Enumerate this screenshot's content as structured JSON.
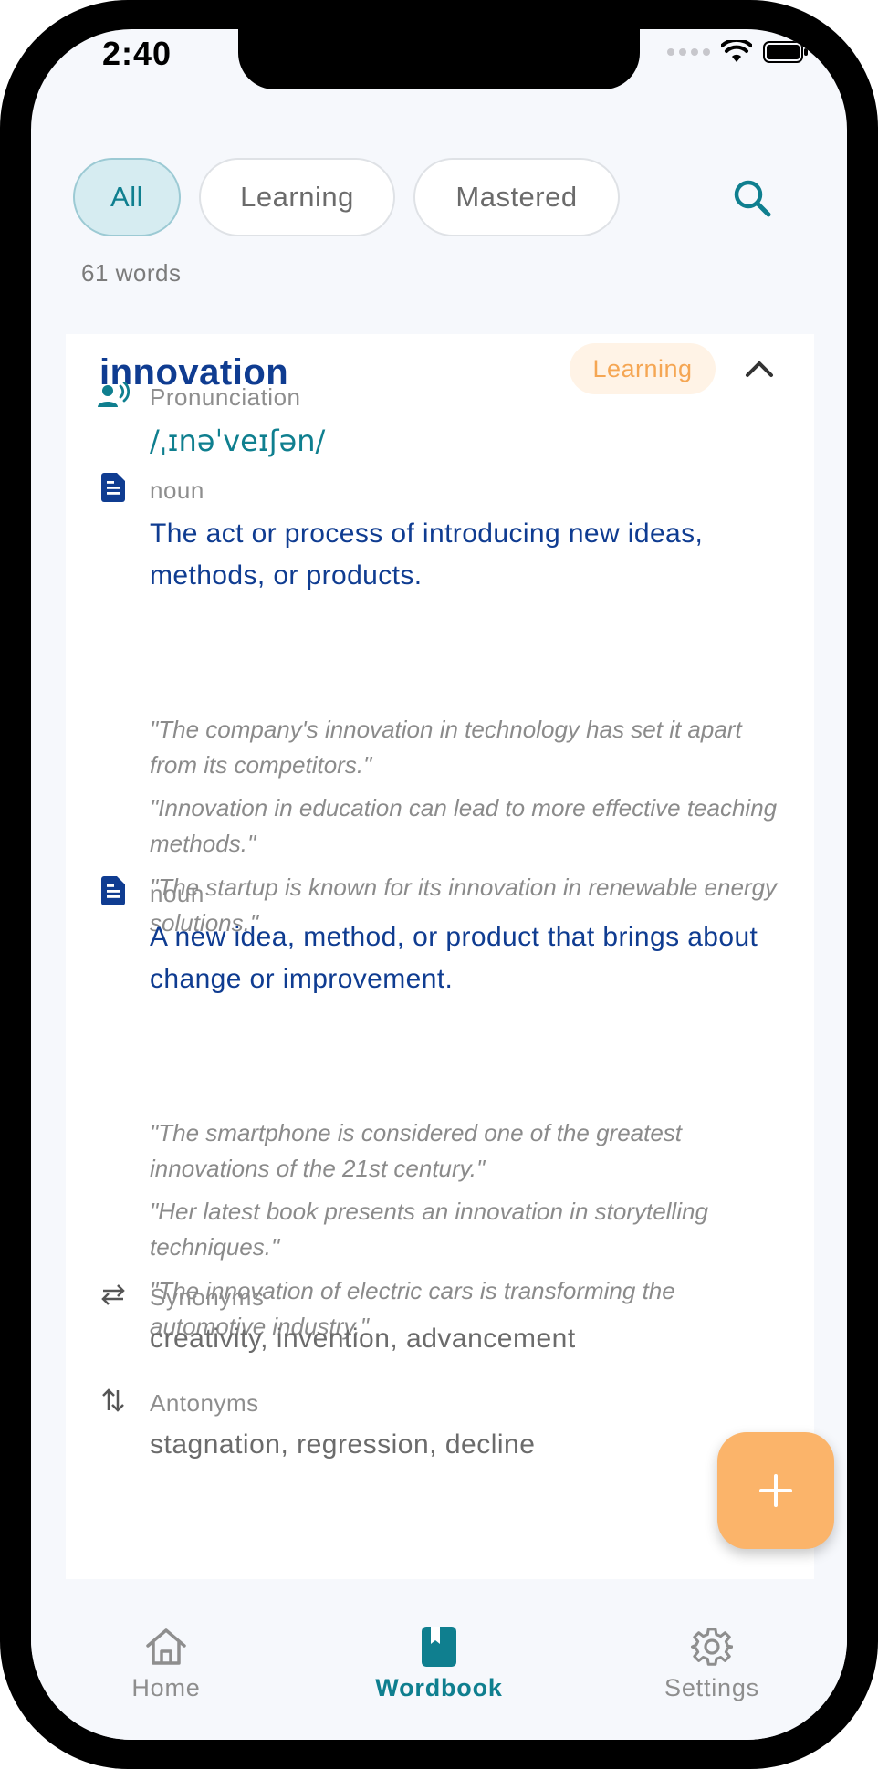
{
  "status_bar": {
    "time": "2:40"
  },
  "filters": {
    "items": [
      {
        "label": "All",
        "active": true
      },
      {
        "label": "Learning",
        "active": false
      },
      {
        "label": "Mastered",
        "active": false
      }
    ]
  },
  "word_count": "61 words",
  "card": {
    "word": "innovation",
    "status": "Learning",
    "pronunciation_label": "Pronunciation",
    "pronunciation": "/ˌɪnəˈveɪʃən/",
    "meanings": [
      {
        "part_of_speech": "noun",
        "definition": "The act or process of introducing new ideas, methods, or products.",
        "examples": [
          "\"The company's innovation in technology has set it apart from its competitors.\"",
          "\"Innovation in education can lead to more effective teaching methods.\"",
          "\"The startup is known for its innovation in renewable energy solutions.\""
        ]
      },
      {
        "part_of_speech": "noun",
        "definition": "A new idea, method, or product that brings about change or improvement.",
        "examples": [
          "\"The smartphone is considered one of the greatest innovations of the 21st century.\"",
          "\"Her latest book presents an innovation in storytelling techniques.\"",
          "\"The innovation of electric cars is transforming the automotive industry.\""
        ]
      }
    ],
    "synonyms_label": "Synonyms",
    "synonyms": "creativity, invention, advancement",
    "antonyms_label": "Antonyms",
    "antonyms": "stagnation, regression, decline"
  },
  "nav": {
    "items": [
      {
        "label": "Home",
        "icon": "home-icon",
        "active": false
      },
      {
        "label": "Wordbook",
        "icon": "book-icon",
        "active": true
      },
      {
        "label": "Settings",
        "icon": "gear-icon",
        "active": false
      }
    ]
  },
  "colors": {
    "primary_teal": "#0f7f8f",
    "title_blue": "#0f3c91",
    "accent_orange": "#fbb46a",
    "badge_text": "#f5a653"
  }
}
